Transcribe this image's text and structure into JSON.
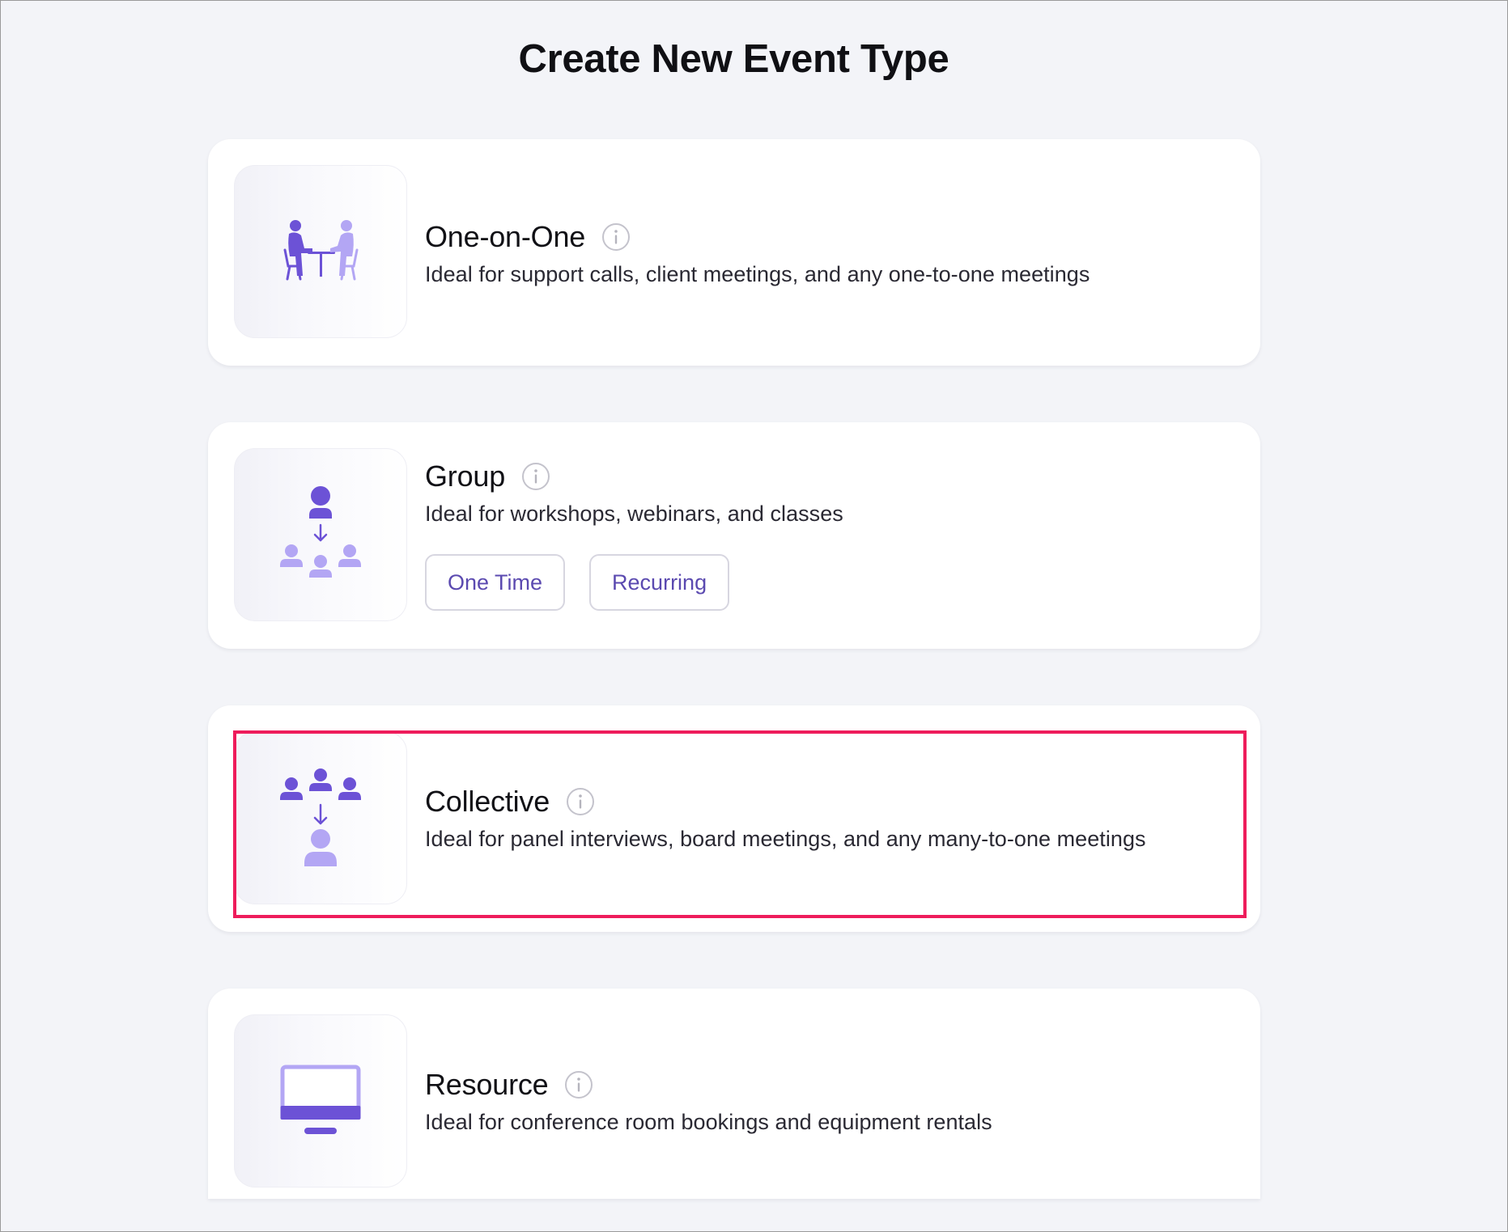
{
  "page": {
    "title": "Create New Event Type"
  },
  "colors": {
    "accent_dark": "#6c52d6",
    "accent_light": "#b3a6f4",
    "highlight": "#ee1c5b",
    "chip_text": "#5b4ab0"
  },
  "event_types": [
    {
      "title": "One-on-One",
      "description": "Ideal for support calls, client meetings, and any one-to-one meetings",
      "icon": "one-on-one-meeting-icon"
    },
    {
      "title": "Group",
      "description": "Ideal for workshops, webinars, and classes",
      "icon": "group-presenter-icon",
      "options": [
        "One Time",
        "Recurring"
      ]
    },
    {
      "title": "Collective",
      "description": "Ideal for panel interviews, board meetings, and any many-to-one meetings",
      "icon": "collective-panel-icon",
      "highlighted": true
    },
    {
      "title": "Resource",
      "description": "Ideal for conference room bookings and equipment rentals",
      "icon": "monitor-resource-icon"
    }
  ]
}
